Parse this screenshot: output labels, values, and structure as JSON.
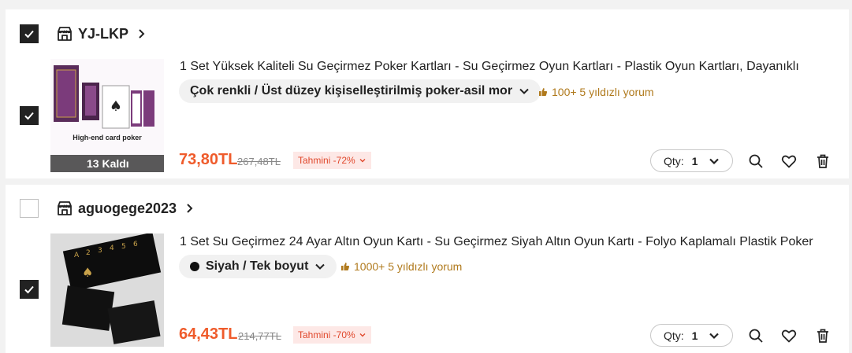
{
  "stores": [
    {
      "name": "YJ-LKP",
      "store_checked": true,
      "item_checked": true,
      "thumb_label": "High-end card poker",
      "stock": "13 Kaldı",
      "title": "1 Set Yüksek Kaliteli Su Geçirmez Poker Kartları - Su Geçirmez Oyun Kartları - Plastik Oyun Kartları, Dayanıklı",
      "variant": "Çok renkli / Üst düzey kişiselleştirilmiş poker-asil mor",
      "has_color_dot": false,
      "reviews": "100+ 5 yıldızlı yorum",
      "price": "73,80TL",
      "old_price": "267,48TL",
      "discount": "Tahmini -72%",
      "qty_label": "Qty:",
      "qty": "1"
    },
    {
      "name": "aguogege2023",
      "store_checked": false,
      "item_checked": true,
      "thumb_label": "",
      "stock": "",
      "title": "1 Set Su Geçirmez 24 Ayar Altın Oyun Kartı - Su Geçirmez Siyah Altın Oyun Kartı - Folyo Kaplamalı Plastik Poker",
      "variant": "Siyah / Tek boyut",
      "has_color_dot": true,
      "reviews": "1000+ 5 yıldızlı yorum",
      "price": "64,43TL",
      "old_price": "214,77TL",
      "discount": "Tahmini -70%",
      "qty_label": "Qty:",
      "qty": "1"
    }
  ],
  "colors": {
    "price": "#ef5b2b",
    "review": "#b07a1d",
    "discount_bg": "#fde8e6",
    "checkbox_on": "#222222"
  },
  "icons": [
    "store-icon",
    "chevron-right-icon",
    "chevron-down-icon",
    "thumbs-up-icon",
    "search-icon",
    "heart-icon",
    "trash-icon",
    "checkmark-icon"
  ]
}
